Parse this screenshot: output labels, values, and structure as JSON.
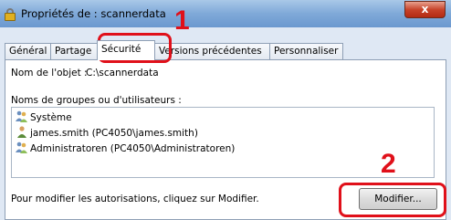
{
  "window": {
    "title": "Propriétés de : scannerdata",
    "close_glyph": "x"
  },
  "tabs": [
    {
      "label": "Général"
    },
    {
      "label": "Partage"
    },
    {
      "label": "Sécurité",
      "active": true
    },
    {
      "label": "Versions précédentes"
    },
    {
      "label": "Personnaliser"
    }
  ],
  "security": {
    "object_name_label": "Nom de l'objet :",
    "object_name_value": "C:\\scannerdata",
    "groups_label": "Noms de groupes ou d'utilisateurs :",
    "users": [
      {
        "label": "Système",
        "icon": "group-icon"
      },
      {
        "label": "james.smith (PC4050\\james.smith)",
        "icon": "user-icon"
      },
      {
        "label": "Administratoren (PC4050\\Administratoren)",
        "icon": "group-icon"
      }
    ],
    "modify_note": "Pour modifier les autorisations, cliquez sur Modifier.",
    "modify_button": "Modifier..."
  },
  "annotations": {
    "step1": "1",
    "step2": "2",
    "highlight_color": "#e0101a"
  }
}
